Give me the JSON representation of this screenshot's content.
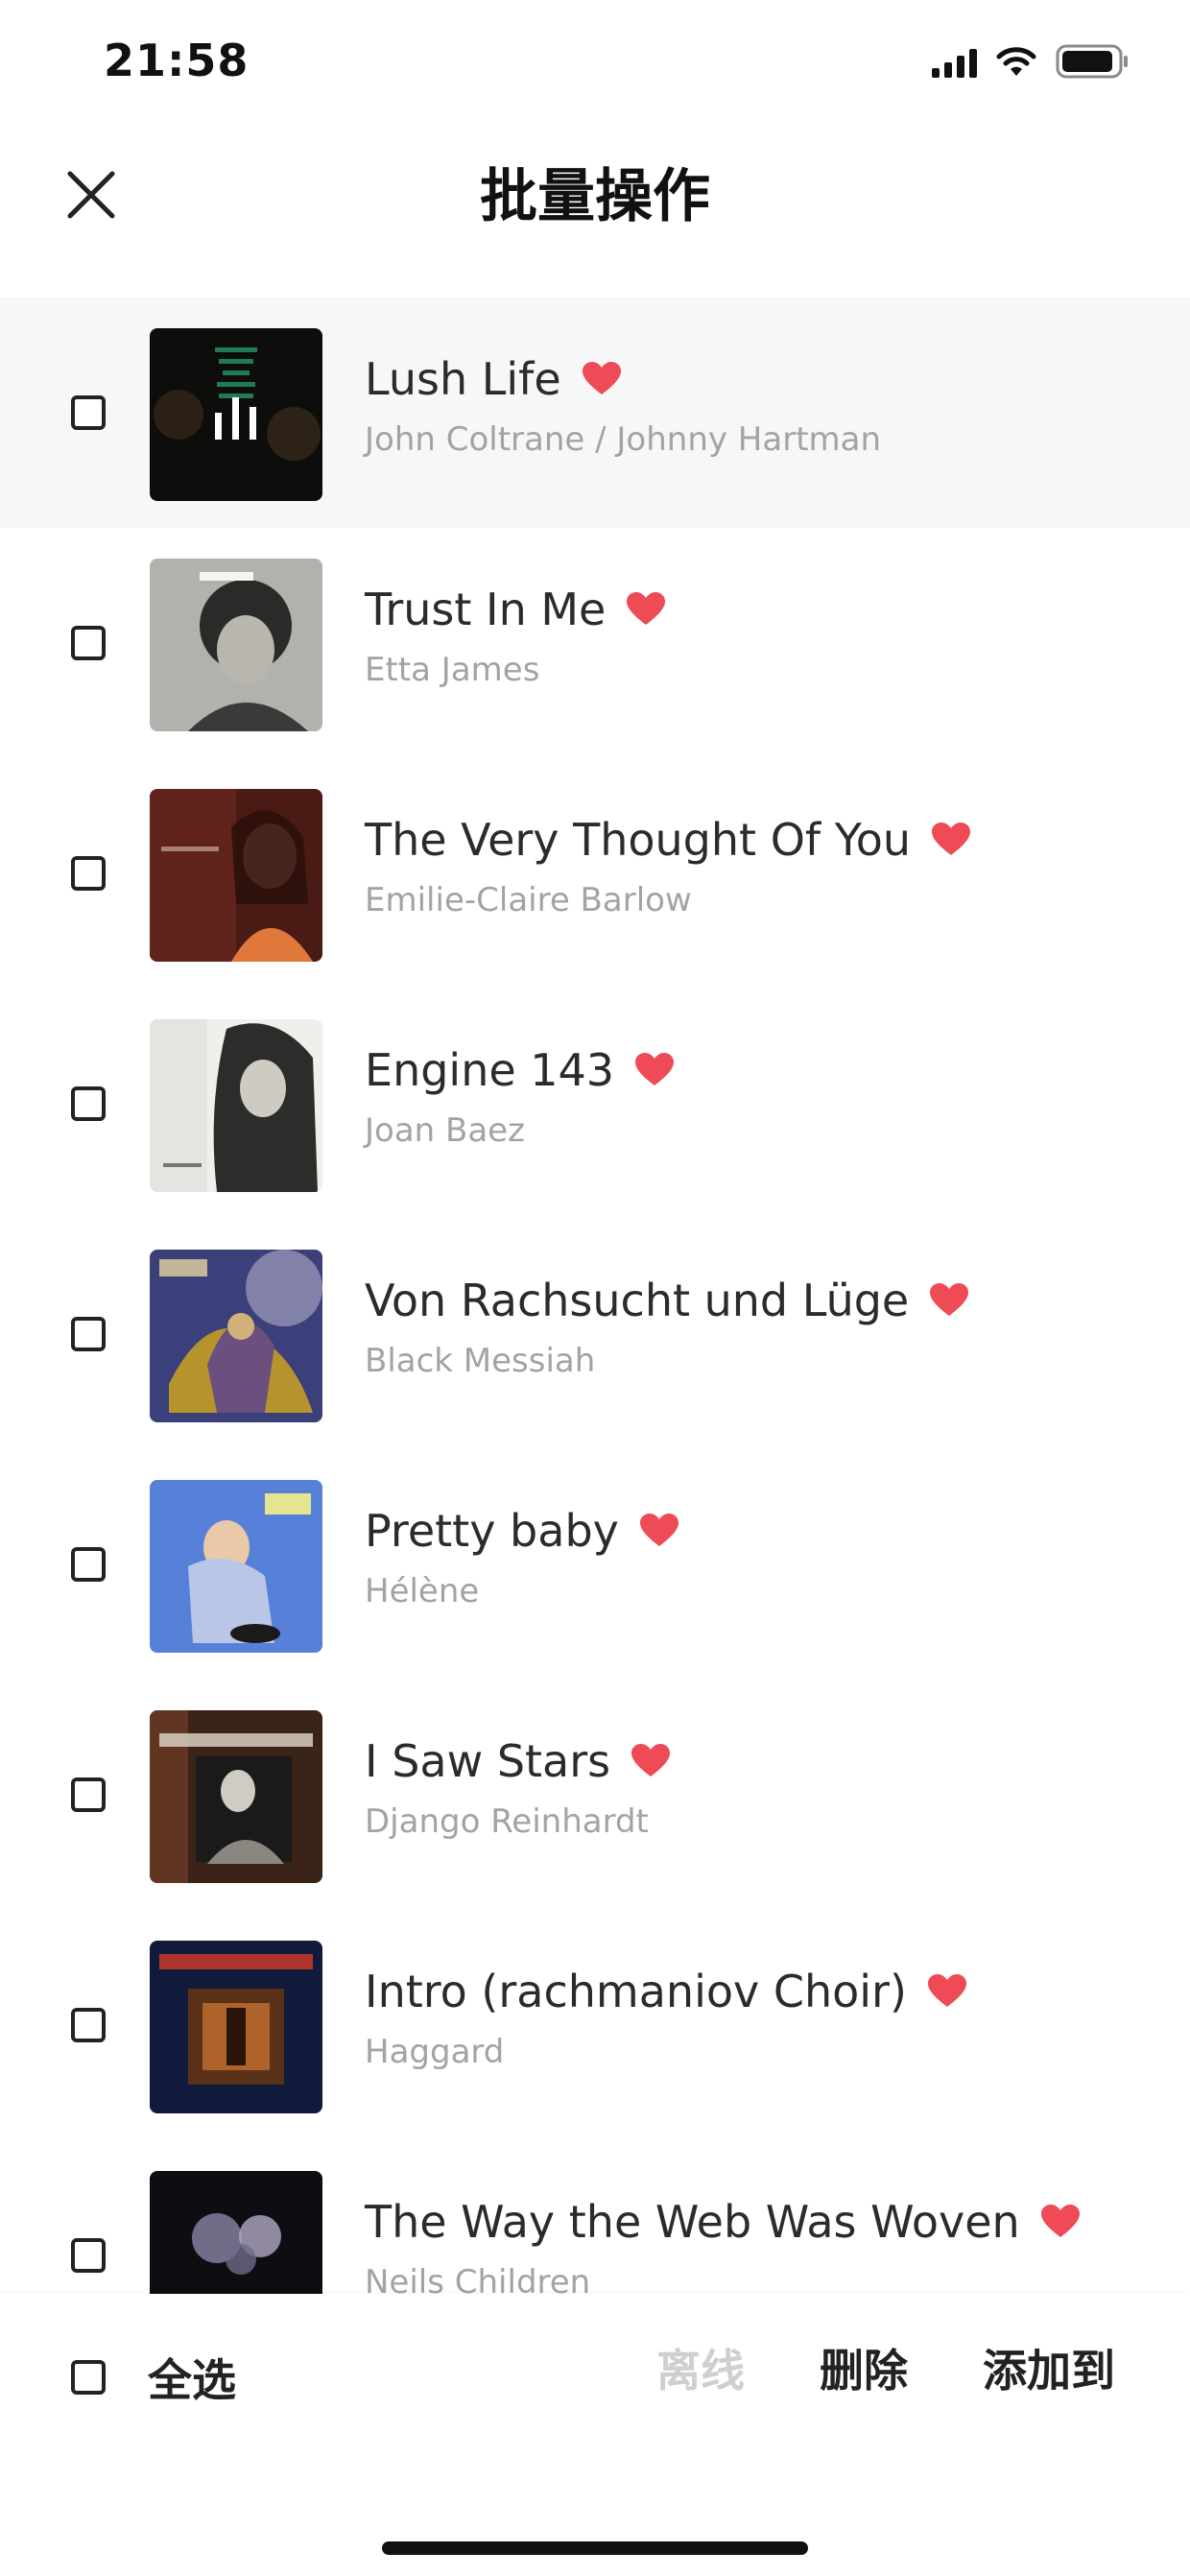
{
  "status_bar": {
    "time": "21:58"
  },
  "header": {
    "title": "批量操作"
  },
  "songs": [
    {
      "title": "Lush Life",
      "artist": "John Coltrane / Johnny Hartman",
      "liked": true,
      "playing": true
    },
    {
      "title": "Trust In Me",
      "artist": "Etta James",
      "liked": true
    },
    {
      "title": "The Very Thought Of You",
      "artist": "Emilie-Claire Barlow",
      "liked": true
    },
    {
      "title": "Engine 143",
      "artist": "Joan Baez",
      "liked": true
    },
    {
      "title": "Von Rachsucht und Lüge",
      "artist": "Black Messiah",
      "liked": true
    },
    {
      "title": "Pretty baby",
      "artist": "Hélène",
      "liked": true
    },
    {
      "title": "I Saw Stars",
      "artist": "Django Reinhardt",
      "liked": true
    },
    {
      "title": "Intro (rachmaniov Choir)",
      "artist": "Haggard",
      "liked": true
    },
    {
      "title": "The Way the Web Was Woven",
      "artist": "Neils Children",
      "liked": true
    }
  ],
  "bottom_bar": {
    "select_all": "全选",
    "offline": "离线",
    "delete": "删除",
    "add_to": "添加到"
  },
  "colors": {
    "heart": "#ef4b57",
    "highlight_row": "#f7f7f7",
    "disabled_text": "#cfcfcf"
  }
}
